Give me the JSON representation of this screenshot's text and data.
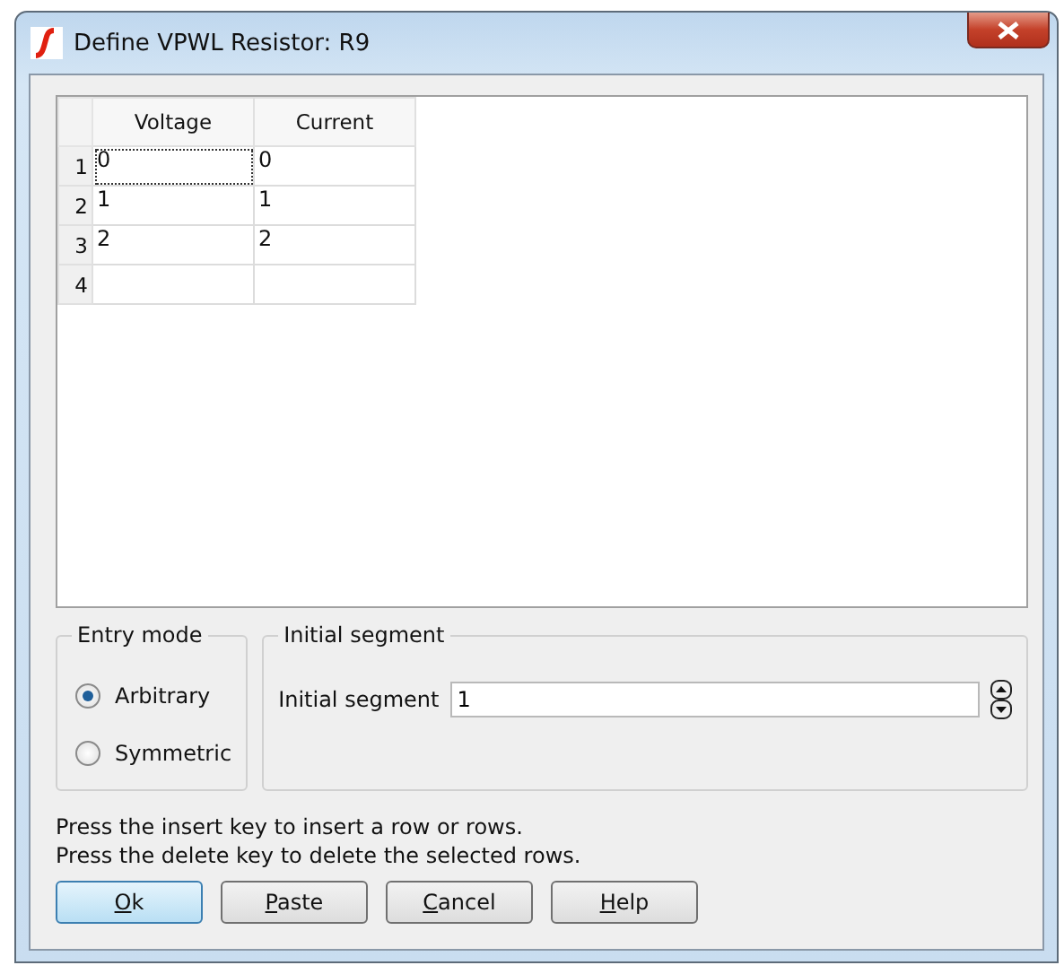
{
  "window": {
    "title": "Define VPWL Resistor: R9"
  },
  "table": {
    "columns": [
      "Voltage",
      "Current"
    ],
    "rows": [
      {
        "header": "1",
        "cells": [
          "0",
          "0"
        ],
        "focused": true
      },
      {
        "header": "2",
        "cells": [
          "1",
          "1"
        ],
        "focused": false
      },
      {
        "header": "3",
        "cells": [
          "2",
          "2"
        ],
        "focused": false
      },
      {
        "header": "4",
        "cells": [
          "",
          ""
        ],
        "focused": false
      }
    ]
  },
  "entry_mode": {
    "title": "Entry mode",
    "options": [
      {
        "label": "Arbitrary",
        "selected": true
      },
      {
        "label": "Symmetric",
        "selected": false
      }
    ]
  },
  "initial_segment": {
    "title": "Initial segment",
    "label": "Initial segment",
    "value": "1"
  },
  "hints": [
    "Press the insert key to insert a row or rows.",
    "Press the delete key to delete the selected rows."
  ],
  "buttons": [
    {
      "mnemonic": "O",
      "rest": "k",
      "default": true
    },
    {
      "mnemonic": "P",
      "rest": "aste",
      "default": false
    },
    {
      "mnemonic": "C",
      "rest": "ancel",
      "default": false
    },
    {
      "mnemonic": "H",
      "rest": "elp",
      "default": false
    }
  ]
}
